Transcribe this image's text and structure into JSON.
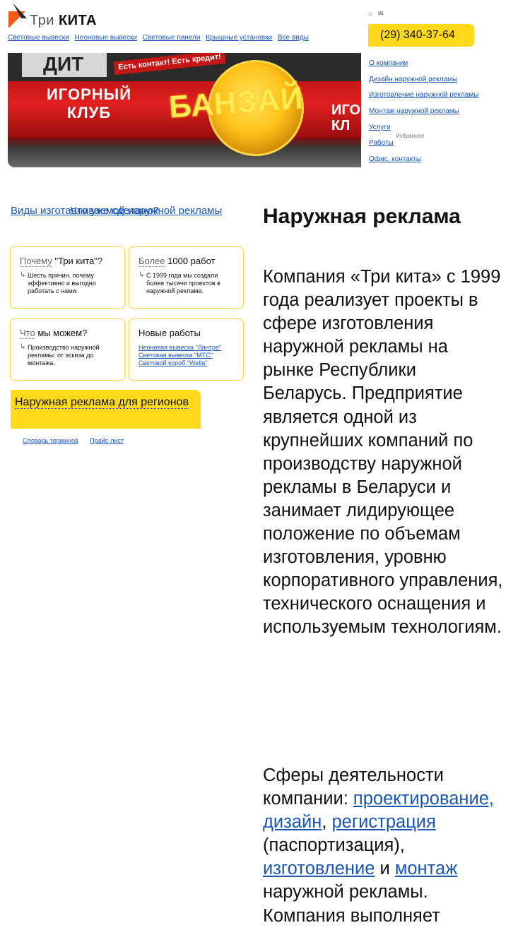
{
  "header": {
    "logo_text_prefix": "Три",
    "logo_text_main": "КИТА",
    "phone": "(29) 340-37-64",
    "top_nav": [
      "Световые вывески",
      "Неоновые вывески",
      "Световые панели",
      "Крышные установки",
      "Все виды"
    ]
  },
  "banner": {
    "left_text": "ИГОРНЫЙ КЛУБ",
    "center_text": "БАНЗАЙ",
    "right_text": "ИГОР КЛ",
    "sign_text": "Есть контакт! Есть кредит!",
    "top_text": "ДИТ"
  },
  "side_nav": {
    "items": [
      "О компании",
      "Дизайн наружной рекламы",
      "Изготовление наружной рекламы",
      "Монтаж наружной рекламы",
      "Услуги",
      "Работы",
      "Офис, контакты"
    ],
    "works_badge": "Избранное"
  },
  "left": {
    "link1": "Виды изготавливаемой наружной рекламы",
    "link2": "Что уже сделано?",
    "boxes": {
      "why": {
        "head_muted": "Почему",
        "head_rest": " \"Три кита\"?",
        "body": "Шесть причин, почему эффективно и выгодно работать с нами."
      },
      "more": {
        "head_muted": "Более",
        "head_rest": " 1000 работ",
        "body": "С 1999 года мы создали более тысячи проектов в наружной рекламе."
      },
      "what": {
        "head_muted": "Что",
        "head_rest": " мы можем?",
        "body": "Производство наружной рекламы: от эскиза до монтажа."
      },
      "new": {
        "head": "Новые работы",
        "links": [
          "Неоновая вывеска \"Лантре\"",
          "Световая вывеска \"МТС\"",
          "Световой короб \"Wella\""
        ]
      }
    },
    "regions": "Наружная реклама для регионов",
    "footer_links": [
      "Словарь терминов",
      "Прайс-лист"
    ]
  },
  "main": {
    "title": "Наружная реклама",
    "paragraph1": "Компания «Три кита» с 1999 года реализует проекты в сфере изготовления наружной рекламы на рынке Республики Беларусь. Предприятие является одной из крупнейших компаний по производству наружной рекламы в Беларуси и занимает лидирующее положение по объемам изготовления, уровню корпоративного управления, технического оснащения и используемым технологиям.",
    "paragraph2_intro": "Сферы деятельности компании: ",
    "link_design": "проектирование, дизайн",
    "link_registration": "регистрация",
    "registration_note": " (паспортизация), ",
    "link_production": "изготовление",
    "and_word": " и ",
    "link_mounting": "монтаж",
    "paragraph2_tail": " наружной рекламы. Компания выполняет"
  },
  "colors": {
    "accent_yellow": "#ffd91a",
    "link_blue": "#1a56b5",
    "logo_orange": "#ef5a1c"
  }
}
